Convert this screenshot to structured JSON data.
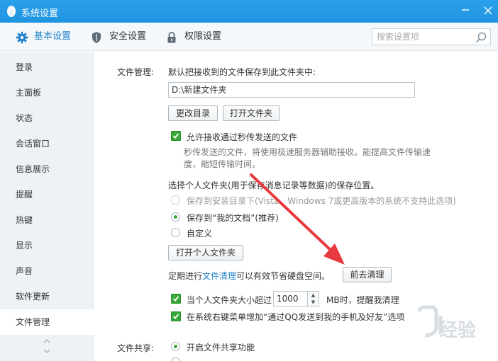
{
  "window": {
    "title": "系统设置"
  },
  "toolbar": {
    "tabs": [
      {
        "label": "基本设置",
        "icon": "gear-icon",
        "active": true
      },
      {
        "label": "安全设置",
        "icon": "shield-icon",
        "active": false
      },
      {
        "label": "权限设置",
        "icon": "lock-icon",
        "active": false
      }
    ],
    "search_placeholder": "搜索设置项"
  },
  "sidebar": {
    "items": [
      {
        "label": "登录"
      },
      {
        "label": "主面板"
      },
      {
        "label": "状态"
      },
      {
        "label": "会话窗口"
      },
      {
        "label": "信息展示"
      },
      {
        "label": "提醒"
      },
      {
        "label": "热键"
      },
      {
        "label": "显示"
      },
      {
        "label": "声音"
      },
      {
        "label": "软件更新"
      },
      {
        "label": "文件管理"
      }
    ],
    "active_index": 10
  },
  "file_mgmt": {
    "section_label": "文件管理:",
    "save_intro": "默认把接收到的文件保存到此文件夹中:",
    "path_value": "D:\\新建文件夹",
    "change_dir_button": "更改目录",
    "open_folder_button": "打开文件夹",
    "allow_flash_label": "允许接收通过秒传发送的文件",
    "allow_flash_desc_line1": "秒传发送的文件，将使用极速服务器辅助接收。能提高文件传输速",
    "allow_flash_desc_line2": "度，缩短传输时间。",
    "personal_folder_intro": "选择个人文件夹(用于保存消息记录等数据)的保存位置。",
    "radio_install_dir": "保存到安装目录下(Vista、Windows 7或更高版本的系统不支持此选项)",
    "radio_my_docs": "保存到“我的文档”(推荐)",
    "radio_custom": "自定义",
    "open_personal_button": "打开个人文件夹",
    "cleanup_prefix": "定期进行",
    "cleanup_link": "文件清理",
    "cleanup_suffix": "可以有效节省硬盘空间。",
    "cleanup_button": "前去清理",
    "size_limit_prefix": "当个人文件夹大小超过",
    "size_limit_value": "1000",
    "size_limit_suffix": "MB时，提醒我清理",
    "context_menu_label": "在系统右键菜单增加“通过QQ发送到我的手机及好友”选项"
  },
  "file_share": {
    "section_label": "文件共享:",
    "enable_label": "开启文件共享功能"
  },
  "watermark": {
    "text": "经验"
  },
  "colors": {
    "accent": "#1f94e0",
    "check": "#38a838",
    "arrow": "#e8393f"
  }
}
